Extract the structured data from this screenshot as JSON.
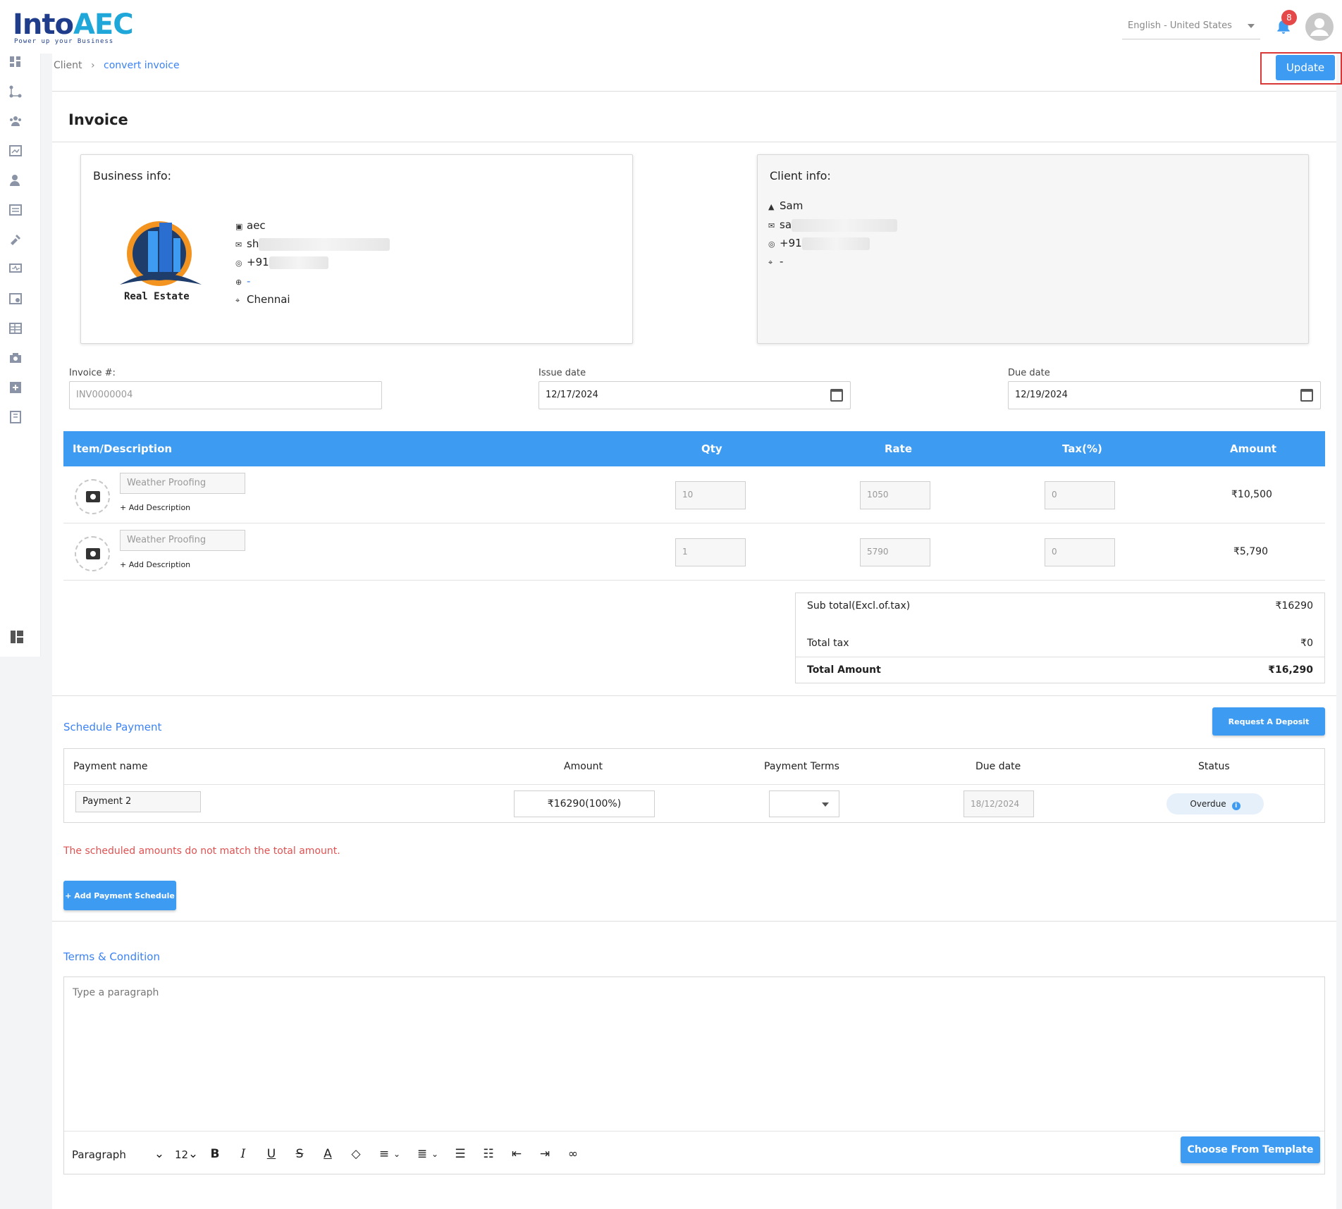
{
  "app": {
    "logo_main": "Into",
    "logo_accent": "AEC",
    "logo_tagline": "Power up your Business",
    "language": "English - United States",
    "notification_count": "8"
  },
  "breadcrumb": {
    "parent": "Client",
    "current": "convert invoice"
  },
  "toolbar": {
    "update_label": "Update"
  },
  "page": {
    "title": "Invoice"
  },
  "business": {
    "title": "Business info:",
    "logo_text": "Real Estate",
    "name": "aec",
    "email": "sh",
    "phone": "+91",
    "website": "-",
    "city": "Chennai"
  },
  "client": {
    "title": "Client info:",
    "name": "Sam",
    "email": "sa",
    "phone": "+91",
    "address": "-"
  },
  "fields": {
    "invoice_label": "Invoice #:",
    "invoice_value": "INV0000004",
    "issue_label": "Issue date",
    "issue_value": "12/17/2024",
    "due_label": "Due date",
    "due_value": "12/19/2024"
  },
  "items": {
    "headers": [
      "Item/Description",
      "Qty",
      "Rate",
      "Tax(%)",
      "Amount"
    ],
    "add_description": "+ Add Description",
    "rows": [
      {
        "name": "Weather Proofing",
        "qty": "10",
        "rate": "1050",
        "tax": "0",
        "amount": "₹10,500"
      },
      {
        "name": "Weather Proofing",
        "qty": "1",
        "rate": "5790",
        "tax": "0",
        "amount": "₹5,790"
      }
    ]
  },
  "totals": {
    "subtotal_label": "Sub total(Excl.of.tax)",
    "subtotal_value": "₹16290",
    "tax_label": "Total tax",
    "tax_value": "₹0",
    "total_label": "Total Amount",
    "total_value": "₹16,290"
  },
  "schedule": {
    "title": "Schedule Payment",
    "request_deposit": "Request A Deposit",
    "headers": [
      "Payment name",
      "Amount",
      "Payment Terms",
      "Due date",
      "Status"
    ],
    "row": {
      "name": "Payment 2",
      "amount": "₹16290(100%)",
      "terms": "",
      "due": "18/12/2024",
      "status": "Overdue"
    },
    "error": "The scheduled amounts do not match the total amount.",
    "add_schedule": "+ Add Payment Schedule"
  },
  "terms": {
    "title": "Terms & Condition",
    "placeholder": "Type a paragraph",
    "toolbar": {
      "block": "Paragraph",
      "size": "12"
    },
    "template_button": "Choose From Template"
  },
  "colors": {
    "primary": "#3e9bf2",
    "error": "#e05252",
    "highlight_box": "#d93838"
  }
}
